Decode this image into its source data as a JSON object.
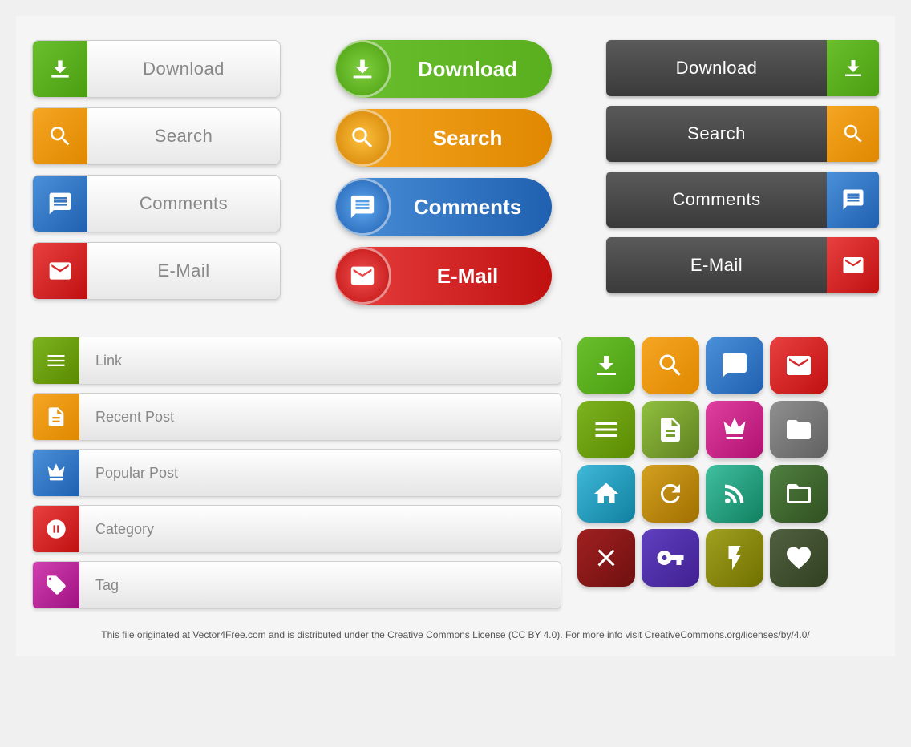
{
  "buttons": {
    "col1": [
      {
        "label": "Download",
        "icon": "download",
        "color": "green"
      },
      {
        "label": "Search",
        "icon": "search",
        "color": "orange"
      },
      {
        "label": "Comments",
        "icon": "comment",
        "color": "blue"
      },
      {
        "label": "E-Mail",
        "icon": "email",
        "color": "red"
      }
    ],
    "col2": [
      {
        "label": "Download",
        "icon": "download",
        "color": "green"
      },
      {
        "label": "Search",
        "icon": "search",
        "color": "orange"
      },
      {
        "label": "Comments",
        "icon": "comment",
        "color": "blue"
      },
      {
        "label": "E-Mail",
        "icon": "email",
        "color": "red"
      }
    ],
    "col3": [
      {
        "label": "Download",
        "icon": "download",
        "color": "green"
      },
      {
        "label": "Search",
        "icon": "search",
        "color": "orange"
      },
      {
        "label": "Comments",
        "icon": "comment",
        "color": "blue"
      },
      {
        "label": "E-Mail",
        "icon": "email",
        "color": "red"
      }
    ]
  },
  "list_buttons": [
    {
      "label": "Link",
      "icon": "menu",
      "color": "olive"
    },
    {
      "label": "Recent Post",
      "icon": "document",
      "color": "orange"
    },
    {
      "label": "Popular Post",
      "icon": "crown",
      "color": "blue"
    },
    {
      "label": "Category",
      "icon": "category",
      "color": "red"
    },
    {
      "label": "Tag",
      "icon": "tag",
      "color": "magenta"
    }
  ],
  "footer": {
    "text": "This file originated at Vector4Free.com and is distributed under the Creative Commons License (CC BY 4.0). For more info visit CreativeCommons.org/licenses/by/4.0/"
  }
}
